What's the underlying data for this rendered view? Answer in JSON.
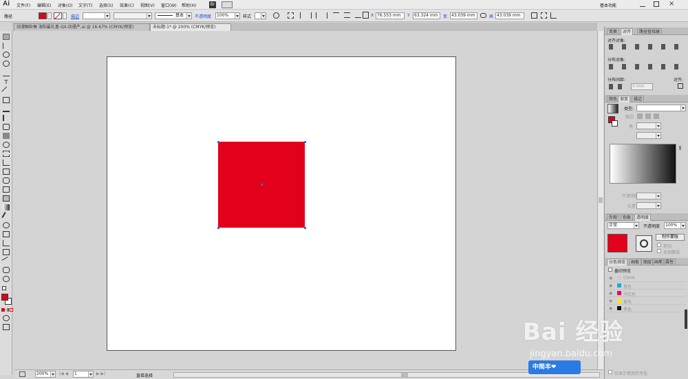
{
  "menubar": {
    "logo": "Ai",
    "items": [
      "文件(F)",
      "编辑(E)",
      "对象(O)",
      "文字(T)",
      "选择(S)",
      "效果(C)",
      "视图(V)",
      "窗口(W)",
      "帮助(H)"
    ],
    "bridge": "Br",
    "workspace": "基本功能"
  },
  "control": {
    "mode_label": "路径",
    "stroke_label": "描边",
    "stroke_style": "基本",
    "opacity_label": "不透明度",
    "opacity_value": "100%",
    "style_label": "样式",
    "x_label": "X",
    "x_value": "76.553 mm",
    "y_label": "Y",
    "y_value": "63.324 mm",
    "w_label": "宽",
    "w_value": "43.039 mm",
    "h_label": "高",
    "h_value": "43.039 mm"
  },
  "tabs": [
    {
      "label": "动漫眼卧蚕 海阳最礼盒-QX-动漫产.ai @ 16.67% (CMYK/预览)"
    },
    {
      "label": "未标题-1* @ 200% (CMYK/预览)"
    }
  ],
  "status": {
    "zoom": "200%",
    "page": "1",
    "tool": "直接选择"
  },
  "panel": {
    "align_tabs": [
      "变换",
      "对齐",
      "路径查找器"
    ],
    "align_objects": "对齐对象:",
    "distribute_objects": "分布对象:",
    "distribute_spacing": "分布间距:",
    "spacing_value": "0 mm",
    "align_to": "对齐:",
    "gradient_tabs": [
      "颜色",
      "渐变",
      "描边"
    ],
    "gradient_type_label": "类型:",
    "gradient_stroke_label": "描边",
    "gradient_angle_label": "角",
    "gradient_opacity_label": "不透明度",
    "gradient_location_label": "位置",
    "transparency_tabs": [
      "外观",
      "色板",
      "透明度"
    ],
    "blend_mode": "正常",
    "transp_opacity_label": "不透明度",
    "transp_opacity_value": "100%",
    "make_mask": "制作蒙版",
    "clip": "剪切",
    "invert": "反相蒙版",
    "sep_tabs": [
      "分色预览",
      "画板",
      "图层",
      "画笔",
      "属性"
    ],
    "overprint": "叠印预览",
    "separations": [
      {
        "name": "CMYK",
        "color": "#cccccc"
      },
      {
        "name": "青色",
        "color": "#1fa9dd"
      },
      {
        "name": "洋红色",
        "color": "#e4007f"
      },
      {
        "name": "黄色",
        "color": "#ffe600"
      },
      {
        "name": "黑色",
        "color": "#111111"
      }
    ],
    "spot_only": "仅显示使用的专色"
  },
  "fill_color": "#e2001a",
  "watermark": {
    "brand": "Bai  经验",
    "url": "jingyan.baidu.com",
    "badge": "中简丰❤"
  }
}
